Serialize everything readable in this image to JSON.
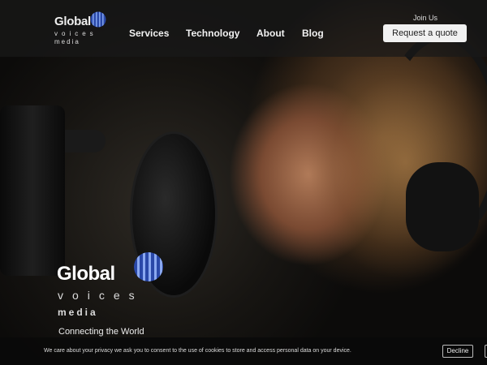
{
  "brand": {
    "name": "Global",
    "sub1": "voices",
    "sub2": "media",
    "globe_icon": "globe-stripes-icon",
    "accent": "#3a5fbf"
  },
  "nav": {
    "items": [
      {
        "label": "Services"
      },
      {
        "label": "Technology"
      },
      {
        "label": "About"
      },
      {
        "label": "Blog"
      }
    ],
    "join_label": "Join Us",
    "cta_label": "Request a quote"
  },
  "hero": {
    "brand_name": "Global",
    "brand_sub1": "voices",
    "brand_sub2": "media",
    "tagline": "Connecting the World"
  },
  "cookie": {
    "text": "We care about your privacy we ask you to consent to the use of cookies to store and access personal data on your device.",
    "decline_label": "Decline"
  }
}
